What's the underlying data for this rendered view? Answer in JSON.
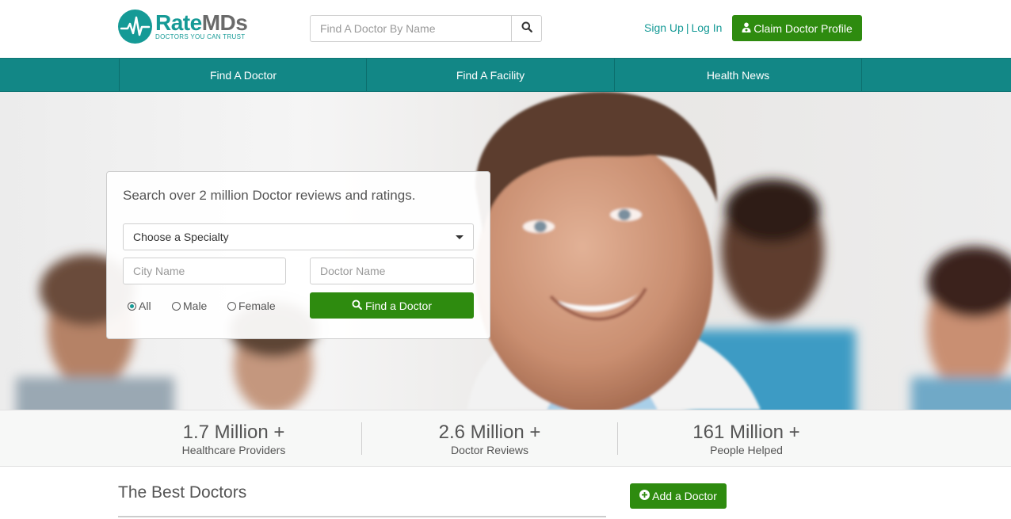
{
  "header": {
    "logo_name_a": "Rate",
    "logo_name_b": "MDs",
    "logo_tagline": "DOCTORS YOU CAN TRUST",
    "search_placeholder": "Find A Doctor By Name",
    "sign_up": "Sign Up",
    "separator": "|",
    "log_in": "Log In",
    "claim_label": "Claim Doctor Profile"
  },
  "nav": {
    "items": [
      {
        "label": "Find A Doctor"
      },
      {
        "label": "Find A Facility"
      },
      {
        "label": "Health News"
      }
    ]
  },
  "search_panel": {
    "title": "Search over 2 million Doctor reviews and ratings.",
    "specialty_selected": "Choose a Specialty",
    "city_placeholder": "City Name",
    "doctor_placeholder": "Doctor Name",
    "gender_options": [
      {
        "label": "All",
        "selected": true
      },
      {
        "label": "Male",
        "selected": false
      },
      {
        "label": "Female",
        "selected": false
      }
    ],
    "find_button": "Find a Doctor"
  },
  "stats": [
    {
      "value": "1.7 Million +",
      "label": "Healthcare Providers"
    },
    {
      "value": "2.6 Million +",
      "label": "Doctor Reviews"
    },
    {
      "value": "161 Million +",
      "label": "People Helped"
    }
  ],
  "best": {
    "title": "The Best Doctors",
    "add_button": "Add a Doctor"
  },
  "colors": {
    "brand_teal": "#159a96",
    "nav_teal": "#128786",
    "action_green": "#2e8b0f"
  }
}
